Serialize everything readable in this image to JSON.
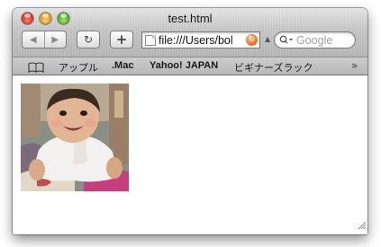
{
  "window": {
    "title": "test.html"
  },
  "toolbar": {
    "back_icon": "back-arrow-icon",
    "forward_icon": "forward-arrow-icon",
    "reload_glyph": "↻",
    "add_glyph": "+",
    "url": "file:///Users/bol",
    "search_placeholder": "Google"
  },
  "bookmarks": {
    "items": [
      "アップル",
      ".Mac",
      "Yahoo! JAPAN",
      "ビギナーズラック"
    ],
    "more_glyph": "»"
  },
  "content": {
    "image_subject": "smiling baby photo"
  },
  "colors": {
    "titlebar": "#c5c5c5",
    "bookmark_bar": "#c2c2c2",
    "close": "#e0443a",
    "minimize": "#e8a326",
    "zoom": "#5fb636"
  }
}
